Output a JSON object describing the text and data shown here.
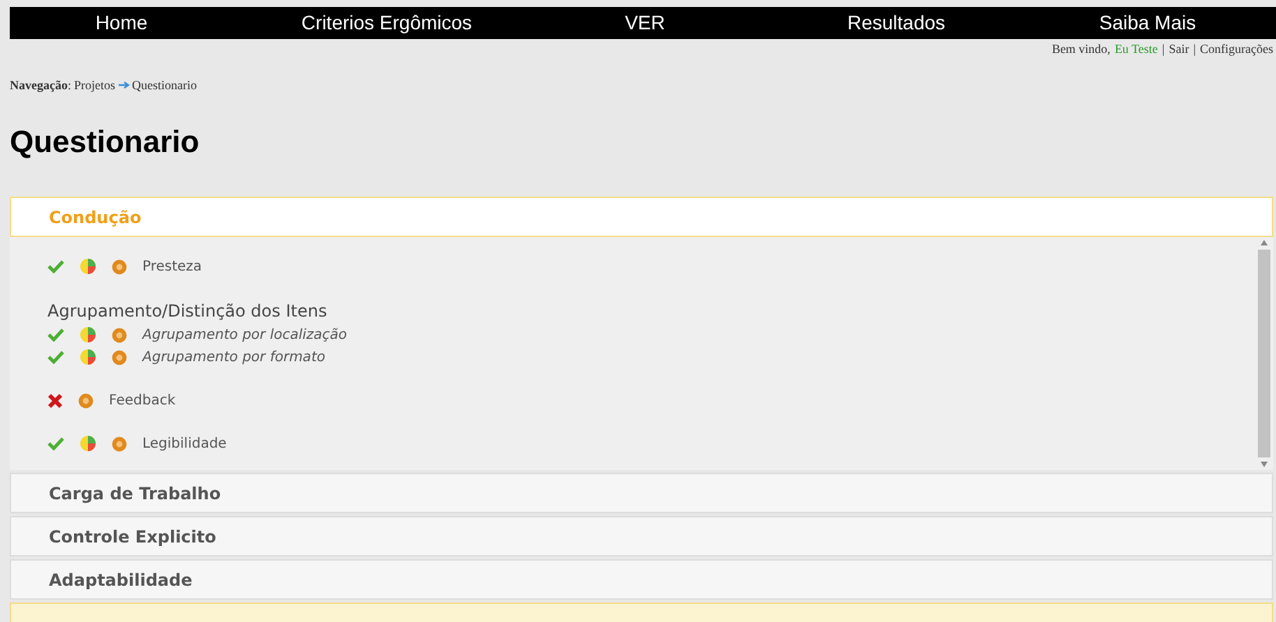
{
  "nav": [
    {
      "label": "Home"
    },
    {
      "label": "Criterios Ergômicos"
    },
    {
      "label": "VER"
    },
    {
      "label": "Resultados"
    },
    {
      "label": "Saiba Mais"
    }
  ],
  "user_bar": {
    "greeting": "Bem vindo,",
    "user": "Eu Teste",
    "separator_1": "|",
    "logout": "Sair",
    "separator_2": "|",
    "settings": "Configurações"
  },
  "breadcrumb": {
    "label": "Navegação",
    "separator": ":",
    "items": [
      {
        "label": "Projetos"
      },
      {
        "label": "Questionario"
      }
    ]
  },
  "title": "Questionario",
  "sections": [
    {
      "title": "Condução",
      "selected": true,
      "hovered": false,
      "items": [
        {
          "kind": "item",
          "label": "Presteza",
          "passed": true
        },
        {
          "kind": "group",
          "title": "Agrupamento/Distinção dos Itens",
          "children": [
            {
              "label": "Agrupamento por localização",
              "passed": true
            },
            {
              "label": "Agrupamento por formato",
              "passed": true
            }
          ]
        },
        {
          "kind": "item",
          "label": "Feedback",
          "passed": false
        },
        {
          "kind": "item",
          "label": "Legibilidade",
          "passed": true
        }
      ]
    },
    {
      "title": "Carga de Trabalho",
      "selected": false,
      "hovered": false
    },
    {
      "title": "Controle Explicito",
      "selected": false,
      "hovered": false
    },
    {
      "title": "Adaptabilidade",
      "selected": false,
      "hovered": false
    },
    {
      "selected": false,
      "hovered": true
    }
  ]
}
